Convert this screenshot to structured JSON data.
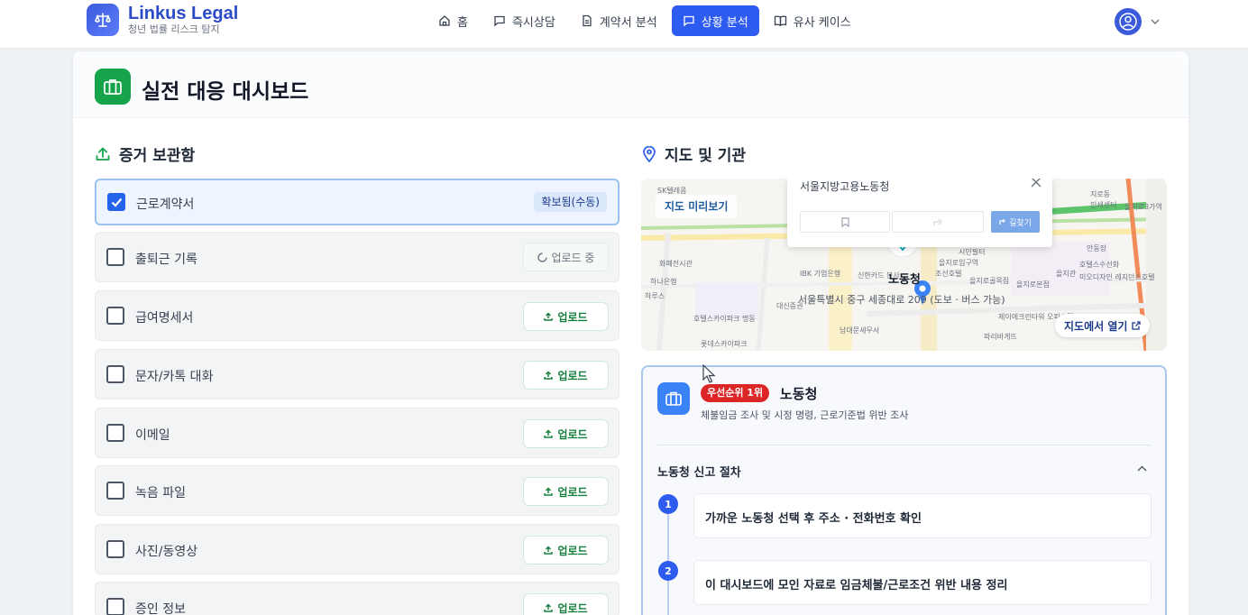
{
  "brand": {
    "name": "Linkus Legal",
    "subtitle": "청년 법률 리스크 탐지"
  },
  "nav": [
    {
      "label": "홈",
      "icon": "home-icon",
      "active": false
    },
    {
      "label": "즉시상담",
      "icon": "chat-icon",
      "active": false
    },
    {
      "label": "계약서 분석",
      "icon": "document-icon",
      "active": false
    },
    {
      "label": "상황 분석",
      "icon": "chat-icon",
      "active": true
    },
    {
      "label": "유사 케이스",
      "icon": "book-icon",
      "active": false
    }
  ],
  "dashboard": {
    "title": "실전 대응 대시보드"
  },
  "evidence": {
    "title": "증거 보관함",
    "items": [
      {
        "label": "근로계약서",
        "checked": true,
        "status": "확보됨(수동)"
      },
      {
        "label": "출퇴근 기록",
        "checked": false,
        "status": "업로드 중"
      },
      {
        "label": "급여명세서",
        "checked": false,
        "status": "업로드"
      },
      {
        "label": "문자/카톡 대화",
        "checked": false,
        "status": "업로드"
      },
      {
        "label": "이메일",
        "checked": false,
        "status": "업로드"
      },
      {
        "label": "녹음 파일",
        "checked": false,
        "status": "업로드"
      },
      {
        "label": "사진/동영상",
        "checked": false,
        "status": "업로드"
      },
      {
        "label": "증인 정보",
        "checked": false,
        "status": "업로드"
      }
    ]
  },
  "map": {
    "title": "지도 및 기관",
    "preview_label": "지도 미리보기",
    "popup_title": "서울지방고용노동청",
    "route_label": "길찾기",
    "marker_label": "노동청",
    "address": "서울특별시 중구 세종대로 209 (도보 · 버스 가능)",
    "open_button": "지도에서 열기",
    "pois": [
      "SK텔레콤",
      "화폐전시관",
      "하나은행",
      "IBK 기업은행",
      "신한카드 본사",
      "대신증권",
      "남대문세무서",
      "을지로입구역",
      "을지로골목집",
      "을지관",
      "을지로3가역",
      "인쇄센터",
      "지로동",
      "시민필터",
      "안동장",
      "호텔스수선화",
      "미오디자인 레지던스호텔",
      "제이에크린타워 오피스텔",
      "파리바게뜨",
      "하루스",
      "호텔스카이파크 명동",
      "롯데스카이파크",
      "조선호텔",
      "을지로본점"
    ]
  },
  "agency": {
    "priority": "우선순위 1위",
    "name": "노동청",
    "description": "체불임금 조사 및 시정 명령, 근로기준법 위반 조사",
    "procedure_title": "노동청 신고 절차",
    "steps": [
      {
        "num": "1",
        "text": "가까운 노동청 선택 후 주소 · 전화번호 확인"
      },
      {
        "num": "2",
        "text": "이 대시보드에 모인 자료로 임금체불/근로조건 위반 내용 정리"
      }
    ]
  },
  "colors": {
    "accent": "#2f5cf0",
    "brand": "#2b4bc7",
    "success": "#16a34a",
    "danger": "#dc2626"
  }
}
